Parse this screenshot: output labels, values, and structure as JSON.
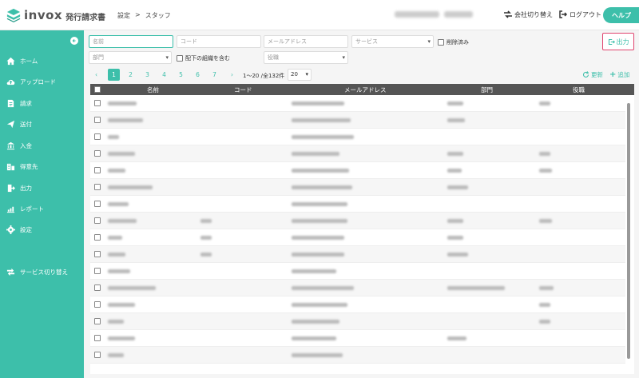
{
  "header": {
    "brand": "invox",
    "product": "発行請求書",
    "breadcrumb": [
      "設定",
      ">",
      "スタッフ"
    ],
    "switch_company": "会社切り替え",
    "logout": "ログアウト",
    "help": "ヘルプ"
  },
  "sidebar": {
    "items": [
      {
        "label": "ホーム",
        "icon": "home-icon"
      },
      {
        "label": "アップロード",
        "icon": "upload-icon"
      },
      {
        "label": "請求",
        "icon": "invoice-icon"
      },
      {
        "label": "送付",
        "icon": "send-icon"
      },
      {
        "label": "入金",
        "icon": "bank-icon"
      },
      {
        "label": "得意先",
        "icon": "building-icon"
      },
      {
        "label": "出力",
        "icon": "export-icon"
      },
      {
        "label": "レポート",
        "icon": "chart-icon"
      },
      {
        "label": "設定",
        "icon": "gear-icon"
      },
      {
        "label": "サービス切り替え",
        "icon": "switch-icon"
      }
    ]
  },
  "filters": {
    "name_placeholder": "名前",
    "code_placeholder": "コード",
    "email_placeholder": "メールアドレス",
    "service_placeholder": "サービス",
    "deleted_label": "削除済み",
    "dept_placeholder": "部門",
    "include_sub_label": "配下の組織を含む",
    "role_placeholder": "役職"
  },
  "export_label": "出力",
  "pagination": {
    "prev": "‹",
    "pages": [
      "1",
      "2",
      "3",
      "4",
      "5",
      "6",
      "7"
    ],
    "next": "›",
    "count": "1〜20 /全132件",
    "per_page": "20"
  },
  "actions": {
    "refresh": "更新",
    "add": "追加"
  },
  "table": {
    "headers": [
      "名前",
      "コード",
      "メールアドレス",
      "部門",
      "役職"
    ],
    "row_count": 16
  },
  "colors": {
    "accent": "#3dbfaa",
    "highlight": "#e0446e",
    "header_bg": "#555555"
  }
}
